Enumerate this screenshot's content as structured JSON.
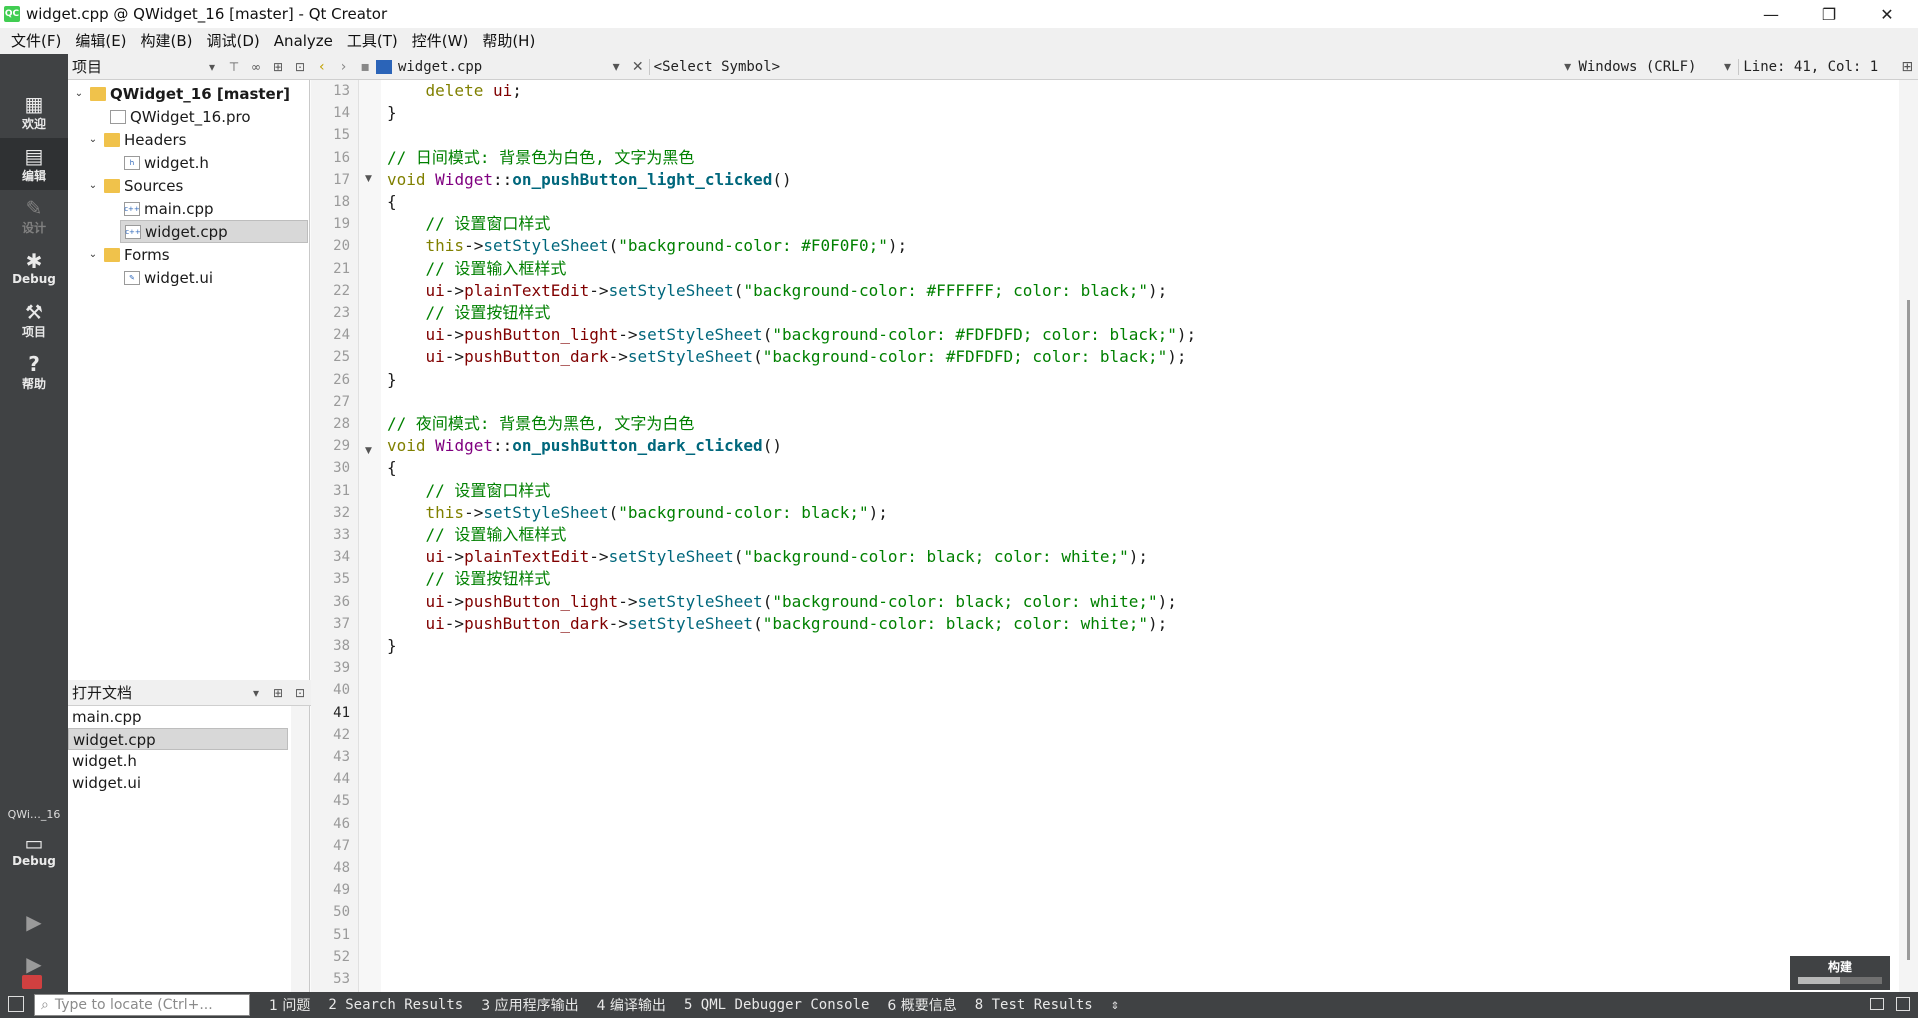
{
  "window": {
    "title": "widget.cpp @ QWidget_16 [master] - Qt Creator",
    "app_icon_text": "QC",
    "controls": {
      "minimize": "—",
      "maximize": "❐",
      "close": "✕"
    }
  },
  "menu": [
    "文件(F)",
    "编辑(E)",
    "构建(B)",
    "调试(D)",
    "Analyze",
    "工具(T)",
    "控件(W)",
    "帮助(H)"
  ],
  "modes": {
    "welcome": "欢迎",
    "edit": "编辑",
    "design": "设计",
    "debug": "Debug",
    "projects": "项目",
    "help": "帮助",
    "kit_name": "QWi…_16",
    "kit_mode": "Debug"
  },
  "project_pane": {
    "header": "项目",
    "tree": [
      {
        "label": "QWidget_16 [master]",
        "type": "project",
        "expanded": true
      },
      {
        "label": "QWidget_16.pro",
        "type": "pro"
      },
      {
        "label": "Headers",
        "type": "folder",
        "expanded": true
      },
      {
        "label": "widget.h",
        "type": "header"
      },
      {
        "label": "Sources",
        "type": "folder",
        "expanded": true
      },
      {
        "label": "main.cpp",
        "type": "cpp"
      },
      {
        "label": "widget.cpp",
        "type": "cpp",
        "selected": true
      },
      {
        "label": "Forms",
        "type": "folder",
        "expanded": true
      },
      {
        "label": "widget.ui",
        "type": "ui"
      }
    ]
  },
  "open_docs": {
    "header": "打开文档",
    "items": [
      "main.cpp",
      "widget.cpp",
      "widget.h",
      "widget.ui"
    ],
    "selected": "widget.cpp"
  },
  "editor_toolbar": {
    "file": "widget.cpp",
    "symbol": "<Select Symbol>",
    "line_endings": "Windows (CRLF)",
    "position": "Line: 41, Col: 1"
  },
  "editor": {
    "first_line": 13,
    "current_line": 41,
    "lines": [
      "    delete ui;",
      "}",
      "",
      "// 日间模式: 背景色为白色, 文字为黑色",
      "void Widget::on_pushButton_light_clicked()",
      "{",
      "    // 设置窗口样式",
      "    this->setStyleSheet(\"background-color: #F0F0F0;\");",
      "    // 设置输入框样式",
      "    ui->plainTextEdit->setStyleSheet(\"background-color: #FFFFFF; color: black;\");",
      "    // 设置按钮样式",
      "    ui->pushButton_light->setStyleSheet(\"background-color: #FDFDFD; color: black;\");",
      "    ui->pushButton_dark->setStyleSheet(\"background-color: #FDFDFD; color: black;\");",
      "}",
      "",
      "// 夜间模式: 背景色为黑色, 文字为白色",
      "void Widget::on_pushButton_dark_clicked()",
      "{",
      "    // 设置窗口样式",
      "    this->setStyleSheet(\"background-color: black;\");",
      "    // 设置输入框样式",
      "    ui->plainTextEdit->setStyleSheet(\"background-color: black; color: white;\");",
      "    // 设置按钮样式",
      "    ui->pushButton_light->setStyleSheet(\"background-color: black; color: white;\");",
      "    ui->pushButton_dark->setStyleSheet(\"background-color: black; color: white;\");",
      "}",
      "",
      "",
      "",
      "",
      "",
      "",
      "",
      "",
      "",
      "",
      "",
      "",
      "",
      "",
      ""
    ]
  },
  "build_widget": {
    "label": "构建"
  },
  "statusbar": {
    "locator_placeholder": "Type to locate (Ctrl+...",
    "panes": [
      "1 问题",
      "2 Search Results",
      "3 应用程序输出",
      "4 编译输出",
      "5 QML Debugger Console",
      "6 概要信息",
      "8 Test Results"
    ]
  },
  "colors": {
    "keyword": "#808000",
    "class": "#800080",
    "function": "#00677c",
    "string": "#008000",
    "comment": "#008000",
    "member": "#800000",
    "modebar": "#404244"
  }
}
